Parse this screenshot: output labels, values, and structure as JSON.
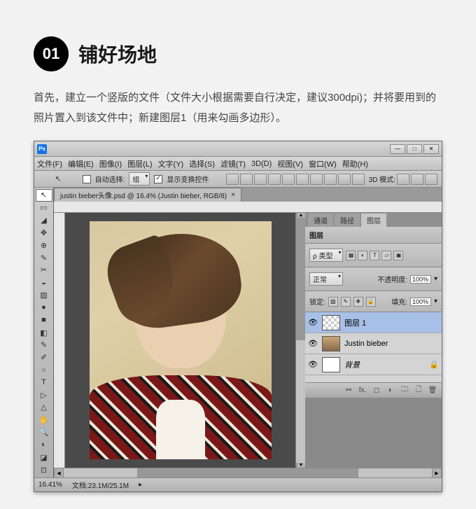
{
  "step": {
    "number": "01",
    "title": "铺好场地"
  },
  "description": "首先，建立一个竖版的文件（文件大小根据需要自行决定，建议300dpi)；并将要用到的照片置入到该文件中；新建图层1（用来勾画多边形）。",
  "app": {
    "icon_label": "Ps"
  },
  "menubar": [
    "文件(F)",
    "编辑(E)",
    "图像(I)",
    "图层(L)",
    "文字(Y)",
    "选择(S)",
    "滤镜(T)",
    "3D(D)",
    "视图(V)",
    "窗口(W)",
    "帮助(H)"
  ],
  "optionsbar": {
    "auto_select_label": "自动选择:",
    "group_label": "组",
    "show_transform_label": "显示变换控件",
    "mode3d_label": "3D 模式:"
  },
  "doc_tab": {
    "label": "justin bieber头像.psd @ 16.4% (Justin bieber, RGB/8)"
  },
  "panels_tabs": {
    "channels": "通道",
    "paths": "路径",
    "layers": "图层"
  },
  "layers_panel": {
    "title": "图层",
    "kind_label": "ρ 类型",
    "blend_mode": "正常",
    "opacity_label": "不透明度:",
    "opacity_value": "100%",
    "lock_label": "锁定:",
    "fill_label": "填充:",
    "fill_value": "100%",
    "rows": [
      {
        "name": "图层 1",
        "selected": true,
        "thumb": "checker",
        "italic": false
      },
      {
        "name": "Justin bieber",
        "selected": false,
        "thumb": "photo",
        "italic": false
      },
      {
        "name": "背景",
        "selected": false,
        "thumb": "white",
        "italic": true,
        "locked": true
      }
    ]
  },
  "status": {
    "zoom": "16.41%",
    "docinfo": "文档:23.1M/25.1M"
  },
  "tools": [
    "↖",
    "▭",
    "◢",
    "✥",
    "⊕",
    "✎",
    "✂",
    "◒",
    "▨",
    "●",
    "■",
    "◧",
    "✎",
    "✐",
    "○",
    "T",
    "▷",
    "△",
    "✋",
    "🔍",
    "◐",
    "◪",
    "⊡"
  ]
}
